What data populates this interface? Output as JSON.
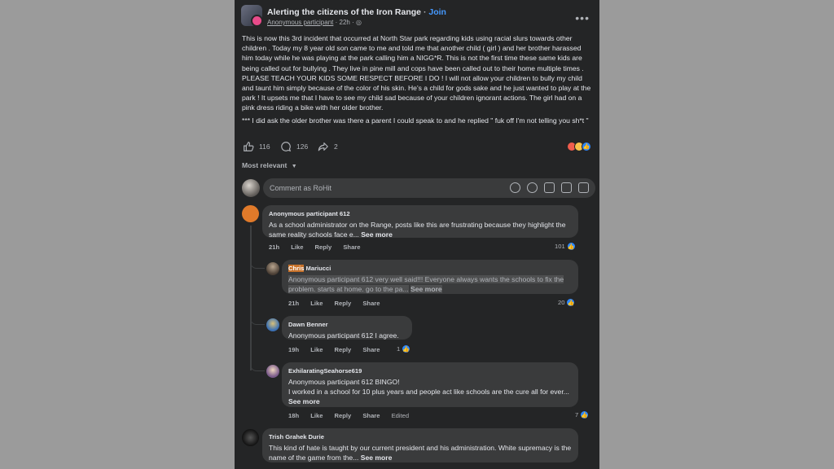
{
  "header": {
    "group_name": "Alerting the citizens of the Iron Range",
    "join_label": "Join",
    "author": "Anonymous participant",
    "time": "22h",
    "more_label": "•••"
  },
  "post": {
    "paragraph1": "This is now this 3rd incident that occurred at North Star park regarding kids using racial slurs towards other children . Today my 8 year old son came to me and told me that another child ( girl ) and her brother harassed him today while he was playing at the park calling him a NIGG*R. This is not the first time these same kids are being called out for bullying . They live in pine mill and cops have been called out to their home multiple times . PLEASE TEACH YOUR KIDS SOME RESPECT BEFORE I DO ! I will not allow your children to bully my child and taunt him simply because of the color of his skin. He's a child for gods sake and he just wanted to play at the park ! It upsets me that I have to see my child sad because of your children ignorant actions. The girl had on a pink dress riding a bike with her older brother.",
    "paragraph2": "*** I did ask the older brother was there a parent I could speak to and he replied \" fuk off I'm not telling you sh*t \""
  },
  "actions": {
    "likes": "116",
    "comments": "126",
    "shares": "2"
  },
  "sort_label": "Most relevant",
  "comment_box": {
    "placeholder": "Comment as RoHit"
  },
  "comments": [
    {
      "name": "Anonymous participant 612",
      "text": "As a school administrator on the Range, posts like this are frustrating because they highlight the same reality schools face e...",
      "see_more": "See more",
      "time": "21h",
      "like": "Like",
      "reply": "Reply",
      "share": "Share",
      "count": "101"
    },
    {
      "name_first": "Chris",
      "name_last": " Mariucci",
      "text": "Anonymous participant 612 very well said!!! Everyone always wants the schools to fix the problem. starts at home. go to the pa...",
      "see_more": "See more",
      "time": "21h",
      "like": "Like",
      "reply": "Reply",
      "share": "Share",
      "count": "20"
    },
    {
      "name": "Dawn Benner",
      "text": "Anonymous participant 612 I agree.",
      "time": "19h",
      "like": "Like",
      "reply": "Reply",
      "share": "Share",
      "count": "1"
    },
    {
      "name": "ExhilaratingSeahorse619",
      "line1": "Anonymous participant 612 BINGO!",
      "text": "I worked in a school for 10 plus years and people act like schools are the cure all for ever...",
      "see_more": "See more",
      "time": "18h",
      "like": "Like",
      "reply": "Reply",
      "share": "Share",
      "edited": "Edited",
      "count": "7"
    },
    {
      "name": "Trish Grahek Durie",
      "text": "This kind of hate is taught by our current president and his administration. White supremacy is the name of the game from the...",
      "see_more": "See more"
    }
  ]
}
